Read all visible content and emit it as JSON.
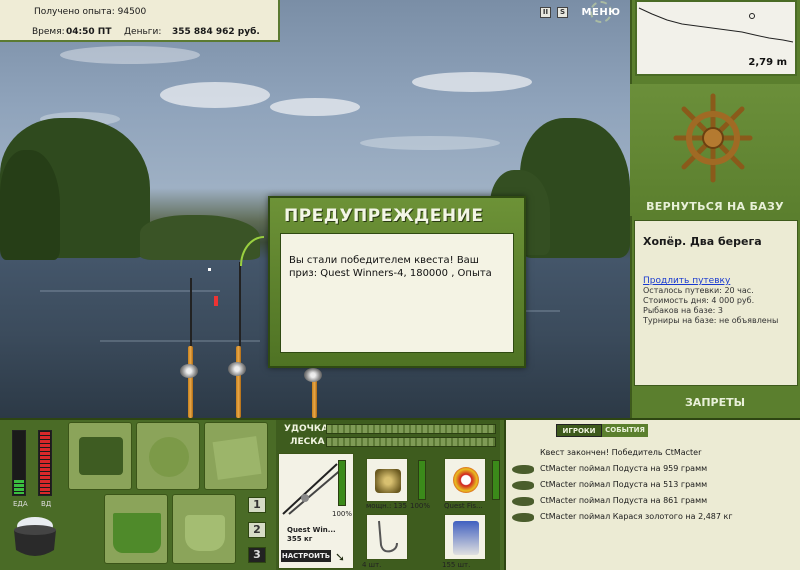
{
  "stats": {
    "experience_label": "Получено опыта:",
    "experience_value": "94500",
    "time_label": "Время:",
    "time_value": "04:50 ПТ",
    "money_label": "Деньги:",
    "money_value": "355 884 962 руб."
  },
  "controls": {
    "pause_label": "II",
    "sound_label": "S",
    "menu_label": "МЕНЮ"
  },
  "depth": {
    "value": "2,79 m"
  },
  "base": {
    "return_label": "ВЕРНУТЬСЯ НА БАЗУ",
    "location_title": "Хопёр. Два берега",
    "extend_link": "Продлить путевку",
    "time_left": "Осталось путевки: 20 час.",
    "day_cost": "Стоимость дня: 4 000 руб.",
    "anglers": "Рыбаков на базе: 3",
    "tournaments": "Турниры на базе: не объявлены",
    "bans_label": "ЗАПРЕТЫ"
  },
  "dialog": {
    "title": "ПРЕДУПРЕЖДЕНИЕ",
    "message": "Вы стали победителем квеста! Ваш приз: Quest Winners-4, 180000 , Опыта"
  },
  "meters": {
    "food_label": "ЕДА",
    "water_label": "ВД"
  },
  "inventory": {
    "page_buttons": [
      "1",
      "2",
      "3"
    ],
    "active_page": 2
  },
  "tackle": {
    "rod_label": "УДОЧКА",
    "line_label": "ЛЕСКА",
    "rod_name": "Quest Win...",
    "rod_weight": "355 кг",
    "rod_condition": "100%",
    "reel_power": "мощн.: 135",
    "reel_condition": "100%",
    "line_name": "Quest Fis...",
    "hooks_count": "4 шт.",
    "bait_count": "155 шт.",
    "setup_button": "НАСТРОИТЬ"
  },
  "log": {
    "tabs": [
      "ИГРОКИ",
      "СОБЫТИЯ"
    ],
    "active_tab": 0,
    "header": "Квест закончен! Победитель CtMacter",
    "entries": [
      "CtMacter поймал Подуста на 959 грамм",
      "CtMacter поймал Подуста на 513 грамм",
      "CtMacter поймал Подуста на 861 грамм",
      "CtMacter поймал Карася золотого на 2,487 кг"
    ]
  },
  "colors": {
    "panel_green": "#5b7f2e",
    "dark_green": "#2e4612",
    "paper": "#ecebd4",
    "link_blue": "#1a3ad0"
  }
}
